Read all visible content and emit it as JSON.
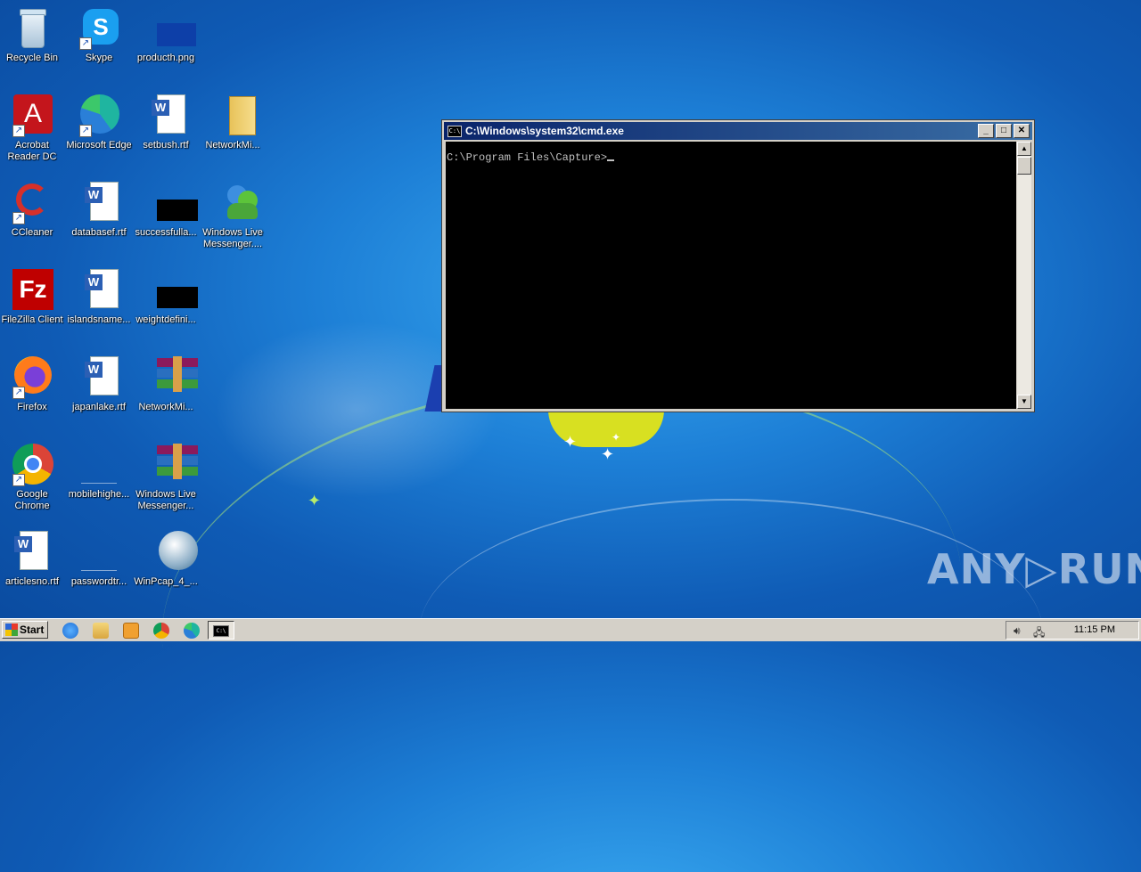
{
  "desktop": {
    "icons": [
      {
        "label": "Recycle Bin"
      },
      {
        "label": "Skype"
      },
      {
        "label": "producth.png"
      },
      {
        "label": "Acrobat Reader DC"
      },
      {
        "label": "Microsoft Edge"
      },
      {
        "label": "setbush.rtf"
      },
      {
        "label": "NetworkMi..."
      },
      {
        "label": "CCleaner"
      },
      {
        "label": "databasef.rtf"
      },
      {
        "label": "successfulla..."
      },
      {
        "label": "Windows Live Messenger...."
      },
      {
        "label": "FileZilla Client"
      },
      {
        "label": "islandsname..."
      },
      {
        "label": "weightdefini..."
      },
      {
        "label": "Firefox"
      },
      {
        "label": "japanlake.rtf"
      },
      {
        "label": "NetworkMi..."
      },
      {
        "label": "Google Chrome"
      },
      {
        "label": "mobilehighe..."
      },
      {
        "label": "Windows Live Messenger..."
      },
      {
        "label": "articlesno.rtf"
      },
      {
        "label": "passwordtr..."
      },
      {
        "label": "WinPcap_4_..."
      }
    ]
  },
  "cmd_window": {
    "title": "C:\\Windows\\system32\\cmd.exe",
    "icon_text": "C:\\",
    "prompt": "C:\\Program Files\\Capture>",
    "minimize": "_",
    "maximize": "□",
    "close": "✕",
    "scroll_up": "▲",
    "scroll_down": "▼"
  },
  "watermark": "ANY▷RUN",
  "taskbar": {
    "start_label": "Start",
    "clock": "11:15 PM",
    "active_icon_text": "C:\\"
  },
  "colors": {
    "titlebar_start": "#0a246a",
    "titlebar_end": "#3a6ea5",
    "desktop_blue": "#1d7fd6"
  }
}
